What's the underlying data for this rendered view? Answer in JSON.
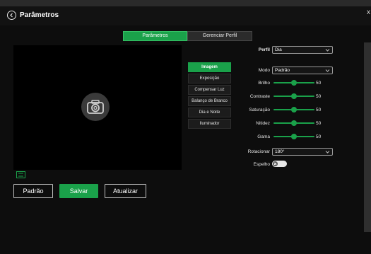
{
  "header": {
    "title": "Parâmetros",
    "close_glyph": "x",
    "back_icon": "circle-chevron-left-icon"
  },
  "tabs": [
    {
      "label": "Parâmetros",
      "active": true
    },
    {
      "label": "Gerenciar Perfil",
      "active": false
    }
  ],
  "preview": {
    "icon": "camera-icon",
    "fit_icon": "fit-window-icon"
  },
  "actions": {
    "default_label": "Padrão",
    "save_label": "Salvar",
    "refresh_label": "Atualizar"
  },
  "menu": [
    {
      "label": "Imagem",
      "active": true
    },
    {
      "label": "Exposição",
      "active": false
    },
    {
      "label": "Compensar Luz",
      "active": false
    },
    {
      "label": "Balanço de Branco",
      "active": false
    },
    {
      "label": "Dia e Noite",
      "active": false
    },
    {
      "label": "Iluminador",
      "active": false
    }
  ],
  "settings": {
    "profile": {
      "label": "Perfil",
      "value": "Dia"
    },
    "mode": {
      "label": "Modo",
      "value": "Padrão"
    },
    "sliders": [
      {
        "label": "Brilho",
        "value": 50,
        "max": 100
      },
      {
        "label": "Contraste",
        "value": 50,
        "max": 100
      },
      {
        "label": "Saturação",
        "value": 50,
        "max": 100
      },
      {
        "label": "Nitidez",
        "value": 50,
        "max": 100
      },
      {
        "label": "Gama",
        "value": 50,
        "max": 100
      }
    ],
    "rotate": {
      "label": "Rotacionar",
      "value": "180°"
    },
    "mirror": {
      "label": "Espelho",
      "enabled": false
    }
  },
  "colors": {
    "accent": "#1aa14a",
    "background": "#0d0d0d"
  }
}
